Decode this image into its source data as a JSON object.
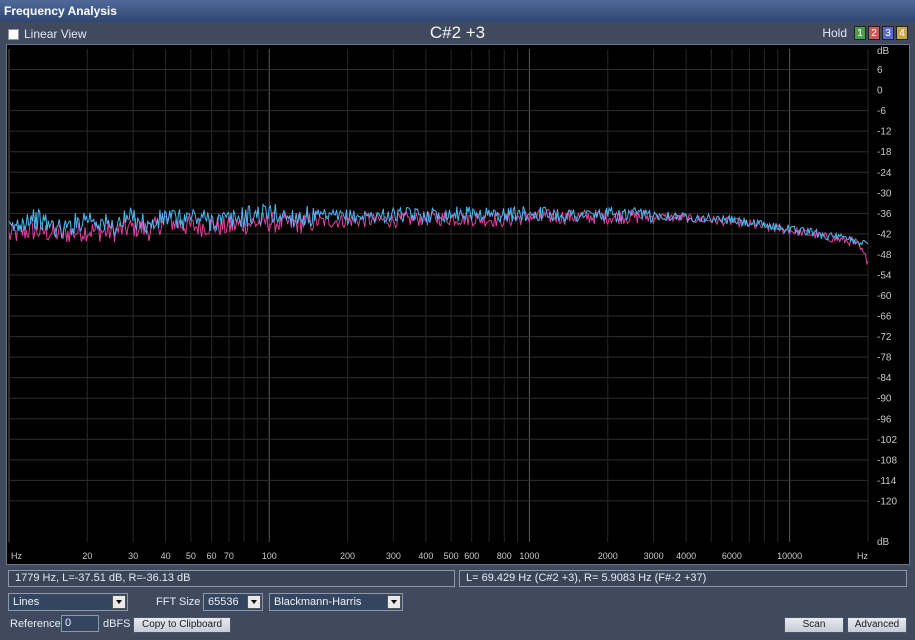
{
  "window": {
    "title": "Frequency Analysis"
  },
  "toolbar": {
    "linear_view_label": "Linear View",
    "linear_view_checked": false,
    "note_title": "C#2 +3",
    "hold_label": "Hold",
    "hold_buttons": [
      {
        "label": "1",
        "color": "#4e9c4e"
      },
      {
        "label": "2",
        "color": "#c85a5a"
      },
      {
        "label": "3",
        "color": "#5a6ac8"
      },
      {
        "label": "4",
        "color": "#c8a84a"
      }
    ]
  },
  "chart_data": {
    "type": "line",
    "x_scale": "log",
    "xlim": [
      10,
      20000
    ],
    "ylim": [
      -132,
      12
    ],
    "x_ticks": [
      {
        "value": 20,
        "label": "20"
      },
      {
        "value": 30,
        "label": "30"
      },
      {
        "value": 40,
        "label": "40"
      },
      {
        "value": 50,
        "label": "50"
      },
      {
        "value": 60,
        "label": "60"
      },
      {
        "value": 70,
        "label": "70"
      },
      {
        "value": 100,
        "label": "100"
      },
      {
        "value": 200,
        "label": "200"
      },
      {
        "value": 300,
        "label": "300"
      },
      {
        "value": 400,
        "label": "400"
      },
      {
        "value": 500,
        "label": "500"
      },
      {
        "value": 600,
        "label": "600"
      },
      {
        "value": 800,
        "label": "800"
      },
      {
        "value": 1000,
        "label": "1000"
      },
      {
        "value": 2000,
        "label": "2000"
      },
      {
        "value": 3000,
        "label": "3000"
      },
      {
        "value": 4000,
        "label": "4000"
      },
      {
        "value": 6000,
        "label": "6000"
      },
      {
        "value": 10000,
        "label": "10000"
      }
    ],
    "x_unit_left": "Hz",
    "x_unit_right": "Hz",
    "y_unit_top": "dB",
    "y_unit_bottom": "dB",
    "y_ticks": [
      6,
      0,
      -6,
      -12,
      -18,
      -24,
      -30,
      -36,
      -42,
      -48,
      -54,
      -60,
      -66,
      -72,
      -78,
      -84,
      -90,
      -96,
      -102,
      -108,
      -114,
      -120
    ],
    "series": [
      {
        "color": "#e0409a",
        "points": [
          [
            10,
            -42.5
          ],
          [
            12,
            -41
          ],
          [
            14,
            -41.5
          ],
          [
            16,
            -42
          ],
          [
            20,
            -41
          ],
          [
            25,
            -41.5
          ],
          [
            30,
            -40
          ],
          [
            35,
            -41
          ],
          [
            40,
            -38
          ],
          [
            45,
            -39
          ],
          [
            50,
            -40
          ],
          [
            60,
            -39.5
          ],
          [
            70,
            -40
          ],
          [
            80,
            -39
          ],
          [
            100,
            -38.5
          ],
          [
            120,
            -39
          ],
          [
            150,
            -38.5
          ],
          [
            200,
            -38
          ],
          [
            300,
            -38
          ],
          [
            400,
            -37.5
          ],
          [
            600,
            -37.5
          ],
          [
            800,
            -38
          ],
          [
            1000,
            -37
          ],
          [
            1500,
            -37
          ],
          [
            2000,
            -37
          ],
          [
            3000,
            -37
          ],
          [
            4000,
            -37.5
          ],
          [
            5000,
            -38
          ],
          [
            6000,
            -38.5
          ],
          [
            8000,
            -40
          ],
          [
            10000,
            -41
          ],
          [
            12000,
            -42
          ],
          [
            15000,
            -43.5
          ],
          [
            18000,
            -44.5
          ],
          [
            20000,
            -50
          ]
        ]
      },
      {
        "color": "#4fb8f2",
        "points": [
          [
            10,
            -41
          ],
          [
            12,
            -37
          ],
          [
            14,
            -39
          ],
          [
            16,
            -41
          ],
          [
            20,
            -37
          ],
          [
            25,
            -40
          ],
          [
            30,
            -37
          ],
          [
            35,
            -40
          ],
          [
            40,
            -37
          ],
          [
            45,
            -38
          ],
          [
            50,
            -37
          ],
          [
            60,
            -38
          ],
          [
            70,
            -38
          ],
          [
            80,
            -37
          ],
          [
            100,
            -36
          ],
          [
            120,
            -37
          ],
          [
            150,
            -37
          ],
          [
            200,
            -37
          ],
          [
            300,
            -36.5
          ],
          [
            400,
            -36.5
          ],
          [
            600,
            -36
          ],
          [
            800,
            -36.5
          ],
          [
            1000,
            -36
          ],
          [
            1500,
            -36.5
          ],
          [
            2000,
            -36.5
          ],
          [
            3000,
            -36.5
          ],
          [
            4000,
            -37
          ],
          [
            5000,
            -37.5
          ],
          [
            6000,
            -38
          ],
          [
            8000,
            -39.5
          ],
          [
            10000,
            -40.5
          ],
          [
            12000,
            -41.5
          ],
          [
            15000,
            -43
          ],
          [
            18000,
            -44
          ],
          [
            20000,
            -45
          ]
        ]
      }
    ]
  },
  "status": {
    "left": "1779 Hz, L=-37.51 dB, R=-36.13 dB",
    "right": "L= 69.429 Hz (C#2 +3), R= 5.9083 Hz (F#-2 +37)"
  },
  "controls": {
    "display_mode": "Lines",
    "fft_size_label": "FFT Size",
    "fft_size": "65536",
    "window_function": "Blackmann-Harris",
    "reference_label": "Reference",
    "reference_value": "0",
    "reference_unit": "dBFS",
    "copy_button": "Copy to Clipboard",
    "scan_button": "Scan",
    "advanced_button": "Advanced"
  }
}
